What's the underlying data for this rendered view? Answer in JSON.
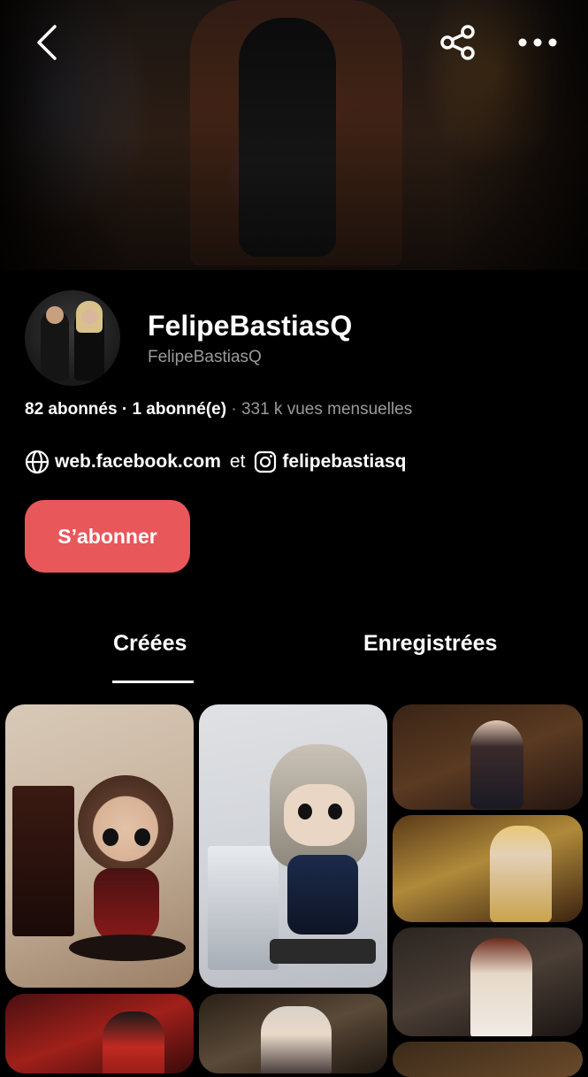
{
  "header": {
    "back_icon": "chevron-left-icon",
    "share_icon": "share-icon",
    "more_icon": "more-horizontal-icon"
  },
  "profile": {
    "name": "FelipeBastiasQ",
    "handle": "FelipeBastiasQ",
    "stats": {
      "followers": "82 abonnés",
      "separator": " · ",
      "following": "1 abonné(e)",
      "monthly_views": " · 331 k vues mensuelles"
    },
    "links": {
      "website": "web.facebook.com",
      "conjunction": "et",
      "instagram": "felipebastiasq"
    },
    "follow_label": "S’abonner"
  },
  "tabs": [
    {
      "label": "Créées",
      "active": true
    },
    {
      "label": "Enregistrées",
      "active": false
    }
  ],
  "colors": {
    "accent": "#e8575a",
    "background": "#000000",
    "muted_text": "#9a9a9a"
  }
}
